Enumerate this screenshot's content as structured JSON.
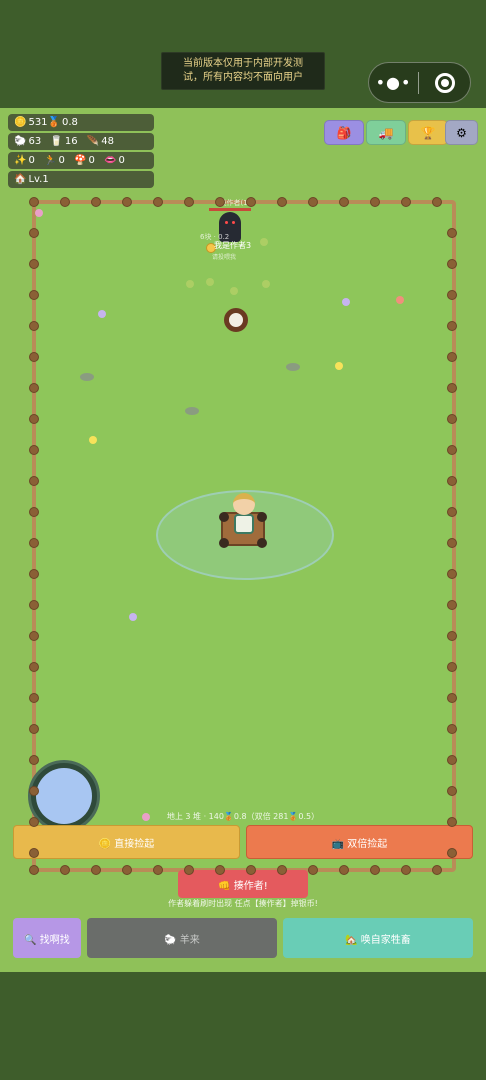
{
  "notice": {
    "line1": "当前版本仅用于内部开发测",
    "line2": "试，所有内容均不面向用户"
  },
  "capsule": {
    "more_glyph": "•●•"
  },
  "stats": {
    "coins": "531",
    "multiplier": "0.8",
    "sheep": "63",
    "milk": "16",
    "feather": "48",
    "star": "0",
    "runner": "0",
    "mushroom": "0",
    "other": "0",
    "level": "Lv.1"
  },
  "top_buttons": [
    {
      "icon": "🎒",
      "color": "#9b8fe3"
    },
    {
      "icon": "🚚",
      "color": "#7fcf9a"
    },
    {
      "icon": "🏆",
      "color": "#e8c14a"
    },
    {
      "icon": "⚙",
      "color": "#a3a8c4"
    }
  ],
  "npc": {
    "name": "操作者(1)",
    "subtitle": "6块 · 0.2",
    "tag": "我是作者3",
    "subtag": "请投喂我"
  },
  "field_info": "地上 3 堆 · 140🥉0.8（双倍 281🥉0.5）",
  "buttons": {
    "pick": "🪙 直接捡起",
    "double": "📺 双倍捡起",
    "operator": "👊 揍作者!",
    "operator_tip": "作者躲着刷时出现 任点【揍作者】掉银币!",
    "find": "🔍 找啊找",
    "sheep": "🐑 羊来",
    "summon": "🏡 唤自家牲畜"
  }
}
